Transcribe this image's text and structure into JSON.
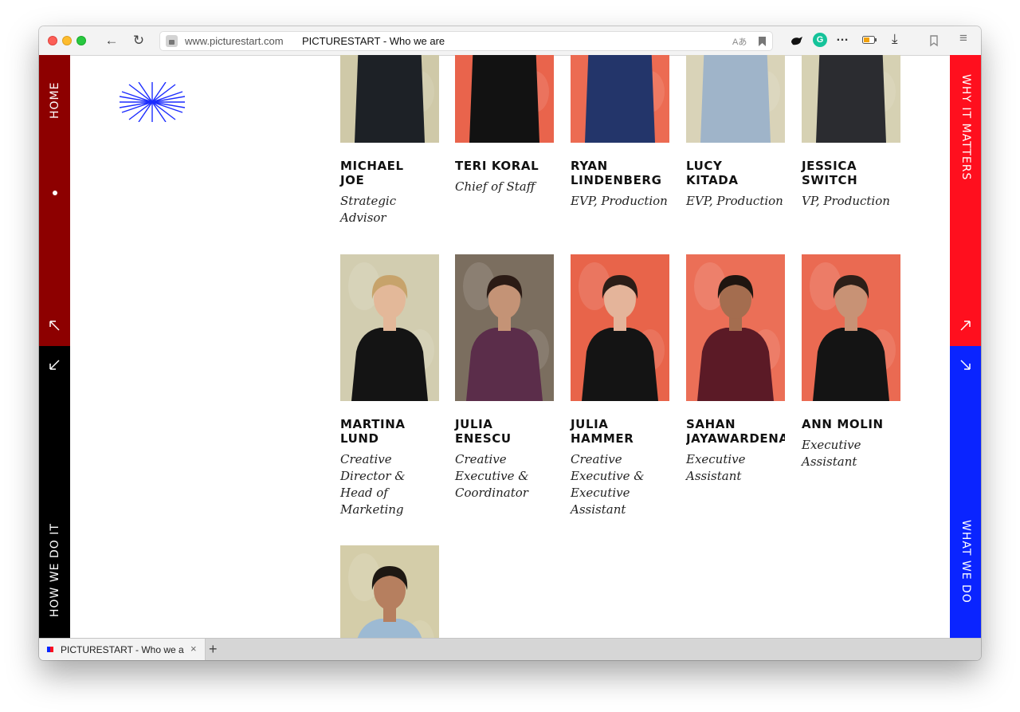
{
  "browser": {
    "url_domain": "www.picturestart.com",
    "page_title": "PICTURESTART - Who we are",
    "tab_title": "PICTURESTART - Who we a",
    "back_icon": "←",
    "reload_icon": "↻",
    "overflow_icon": "…",
    "download_icon": "⤓",
    "menu_icon": "≡",
    "translate_icon": "Aあ",
    "bookmark_icon": "bookmark",
    "grammarly_label": "G",
    "tab_close": "×",
    "new_tab": "+"
  },
  "nav": {
    "home": "HOME",
    "how": "HOW WE DO IT",
    "why": "WHY IT MATTERS",
    "what": "WHAT WE DO"
  },
  "team": [
    {
      "name": "MICHAEL\nJOE",
      "role": "Strategic Advisor",
      "bg": "#cfc9a8",
      "shirt": "#1d2126",
      "skin": "#c79a7d",
      "hair": "#3a2d22",
      "crop": true
    },
    {
      "name": "TERI KORAL",
      "role": "Chief of Staff",
      "bg": "#e9644c",
      "shirt": "#121212",
      "skin": "#dcab8f",
      "hair": "#a57648",
      "crop": true
    },
    {
      "name": "RYAN\nLINDENBERG",
      "role": "EVP, Production",
      "bg": "#ec6b52",
      "shirt": "#23356a",
      "skin": "#d4a084",
      "hair": "#4b3526",
      "crop": true
    },
    {
      "name": "LUCY\nKITADA",
      "role": "EVP, Production",
      "bg": "#d9d3b8",
      "shirt": "#9fb4c9",
      "skin": "#e1b396",
      "hair": "#c9a66d",
      "crop": true
    },
    {
      "name": "JESSICA\nSWITCH",
      "role": "VP, Production",
      "bg": "#d6d1b3",
      "shirt": "#2b2c30",
      "skin": "#e5bea2",
      "hair": "#c8a15f",
      "crop": true
    },
    {
      "name": "MARTINA\nLUND",
      "role": "Creative Director & Head of Marketing",
      "bg": "#d2cdb0",
      "shirt": "#141414",
      "skin": "#e3b899",
      "hair": "#c7a36b",
      "crop": false
    },
    {
      "name": "JULIA\nENESCU",
      "role": "Creative Executive & Coordinator",
      "bg": "#7b6e5f",
      "shirt": "#5b2d4a",
      "skin": "#c49376",
      "hair": "#2b1b15",
      "crop": false
    },
    {
      "name": "JULIA\nHAMMER",
      "role": "Creative Executive & Executive Assistant",
      "bg": "#e8644a",
      "shirt": "#141414",
      "skin": "#e4b49a",
      "hair": "#2c1d17",
      "crop": false
    },
    {
      "name": "SAHAN\nJAYAWARDENA",
      "role": "Executive Assistant",
      "bg": "#eb6f57",
      "shirt": "#5b1a26",
      "skin": "#a46d4f",
      "hair": "#1e1510",
      "crop": false
    },
    {
      "name": "ANN MOLIN",
      "role": "Executive Assistant",
      "bg": "#ea6a52",
      "shirt": "#141414",
      "skin": "#c89275",
      "hair": "#2d1f18",
      "crop": false
    },
    {
      "name": "",
      "role": "",
      "bg": "#d4cda9",
      "shirt": "#9dbad3",
      "skin": "#b67f5f",
      "hair": "#1e1813",
      "crop": false
    }
  ]
}
